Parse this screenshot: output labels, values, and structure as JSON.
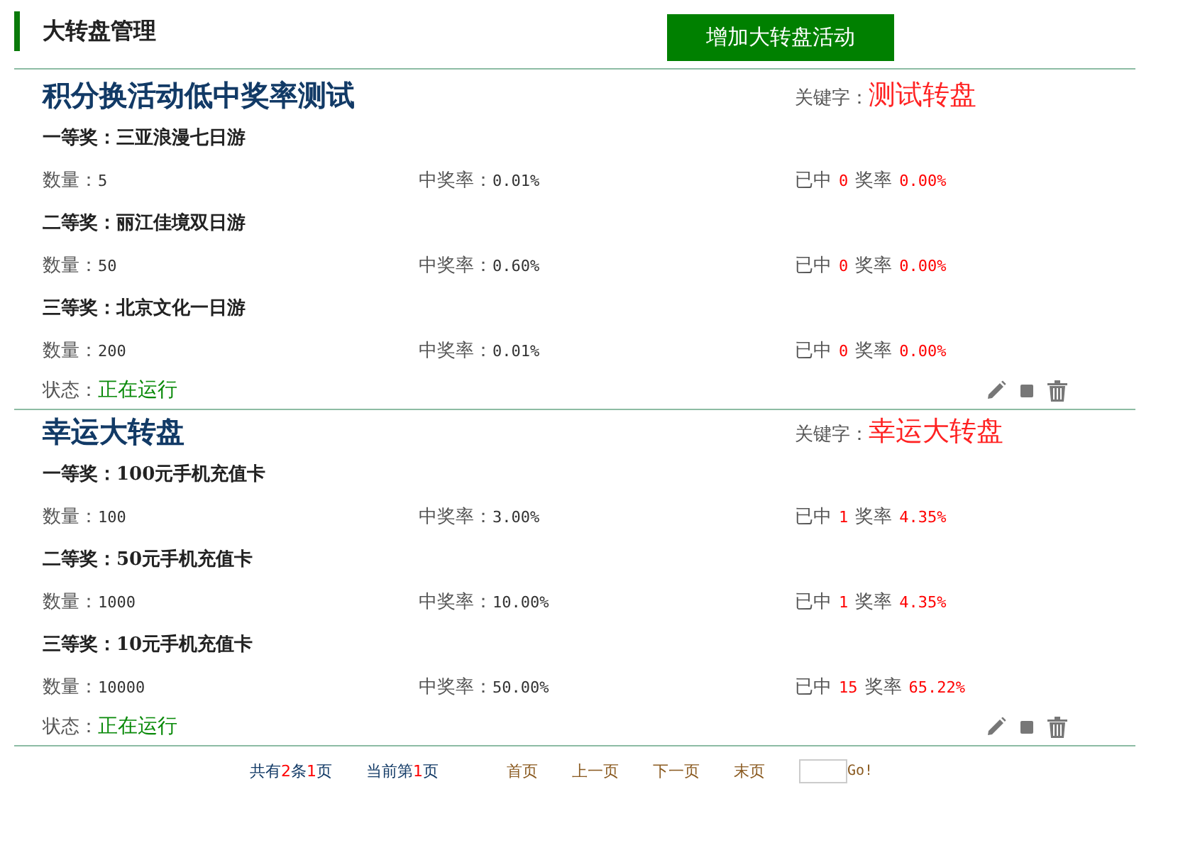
{
  "header": {
    "title": "大转盘管理",
    "add_button": "增加大转盘活动"
  },
  "activities": [
    {
      "name": "积分换活动低中奖率测试",
      "keyword_label": "关键字：",
      "keyword": "测试转盘",
      "prizes": [
        {
          "level": "一等奖：",
          "name": "三亚浪漫七日游",
          "qty_label": "数量：",
          "qty": "5",
          "rate_label": "中奖率：",
          "rate": "0.01%",
          "won_label": "已中",
          "won": "0",
          "actual_label": "奖率",
          "actual": "0.00%"
        },
        {
          "level": "二等奖：",
          "name": "丽江佳境双日游",
          "qty_label": "数量：",
          "qty": "50",
          "rate_label": "中奖率：",
          "rate": "0.60%",
          "won_label": "已中",
          "won": "0",
          "actual_label": "奖率",
          "actual": "0.00%"
        },
        {
          "level": "三等奖：",
          "name": "北京文化一日游",
          "qty_label": "数量：",
          "qty": "200",
          "rate_label": "中奖率：",
          "rate": "0.01%",
          "won_label": "已中",
          "won": "0",
          "actual_label": "奖率",
          "actual": "0.00%"
        }
      ],
      "status_label": "状态：",
      "status": "正在运行"
    },
    {
      "name": "幸运大转盘",
      "keyword_label": "关键字：",
      "keyword": "幸运大转盘",
      "prizes": [
        {
          "level": "一等奖：",
          "name": "100元手机充值卡",
          "qty_label": "数量：",
          "qty": "100",
          "rate_label": "中奖率：",
          "rate": "3.00%",
          "won_label": "已中",
          "won": "1",
          "actual_label": "奖率",
          "actual": "4.35%"
        },
        {
          "level": "二等奖：",
          "name": "50元手机充值卡",
          "qty_label": "数量：",
          "qty": "1000",
          "rate_label": "中奖率：",
          "rate": "10.00%",
          "won_label": "已中",
          "won": "1",
          "actual_label": "奖率",
          "actual": "4.35%"
        },
        {
          "level": "三等奖：",
          "name": "10元手机充值卡",
          "qty_label": "数量：",
          "qty": "10000",
          "rate_label": "中奖率：",
          "rate": "50.00%",
          "won_label": "已中",
          "won": "15",
          "actual_label": "奖率",
          "actual": "65.22%"
        }
      ],
      "status_label": "状态：",
      "status": "正在运行"
    }
  ],
  "pagination": {
    "summary": [
      {
        "text": "共有",
        "highlight": false
      },
      {
        "text": "2",
        "highlight": true
      },
      {
        "text": "条",
        "highlight": false
      },
      {
        "text": "1",
        "highlight": true
      },
      {
        "text": "页",
        "highlight": false
      }
    ],
    "current": [
      {
        "text": "当前第",
        "highlight": false
      },
      {
        "text": "1",
        "highlight": true
      },
      {
        "text": "页",
        "highlight": false
      }
    ],
    "links": [
      "首页",
      "上一页",
      "下一页",
      "末页"
    ],
    "go": "Go!"
  }
}
